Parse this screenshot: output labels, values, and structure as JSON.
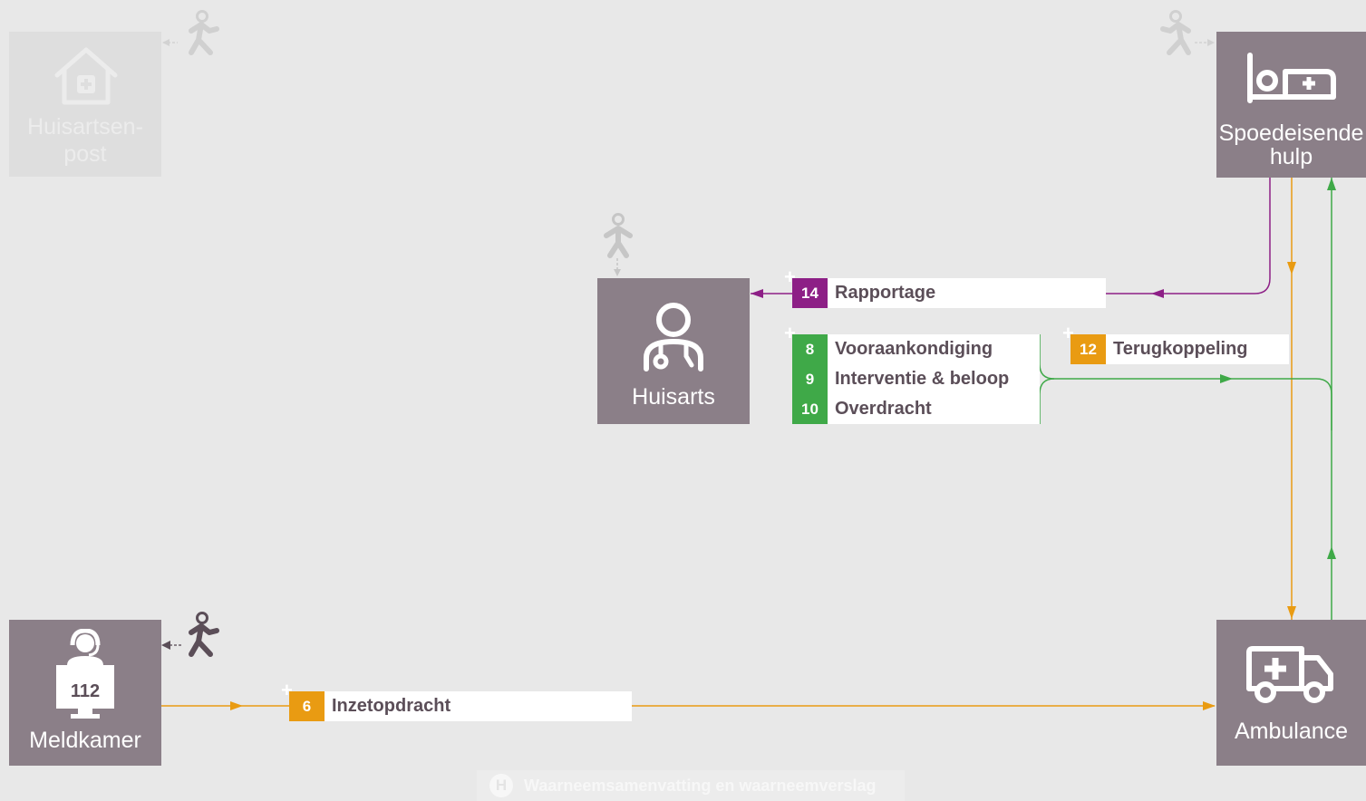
{
  "nodes": {
    "huisartsenpost": {
      "line1": "Huisartsen-",
      "line2": "post"
    },
    "spoedeisende_hulp": {
      "line1": "Spoedeisende",
      "line2": "hulp"
    },
    "huisarts": {
      "label": "Huisarts"
    },
    "meldkamer": {
      "label": "Meldkamer",
      "screen_text": "112"
    },
    "ambulance": {
      "label": "Ambulance"
    }
  },
  "messages": {
    "rapportage": {
      "number": "14",
      "label": "Rapportage",
      "color": "#8d1f86"
    },
    "vooraankondiging": {
      "number": "8",
      "label": "Vooraankondiging",
      "color": "#3fa948"
    },
    "interventie": {
      "number": "9",
      "label": "Interventie & beloop",
      "color": "#3fa948"
    },
    "overdracht": {
      "number": "10",
      "label": "Overdracht",
      "color": "#3fa948"
    },
    "terugkoppeling": {
      "number": "12",
      "label": "Terugkoppeling",
      "color": "#e99b12"
    },
    "inzetopdracht": {
      "number": "6",
      "label": "Inzetopdracht",
      "color": "#e99b12"
    }
  },
  "legend": {
    "mark": "H",
    "label": "Waarneemsamenvatting en waarneemverslag"
  },
  "colors": {
    "node": "#8b7f88",
    "purple": "#8d1f86",
    "green": "#3fa948",
    "orange": "#e99b12"
  }
}
